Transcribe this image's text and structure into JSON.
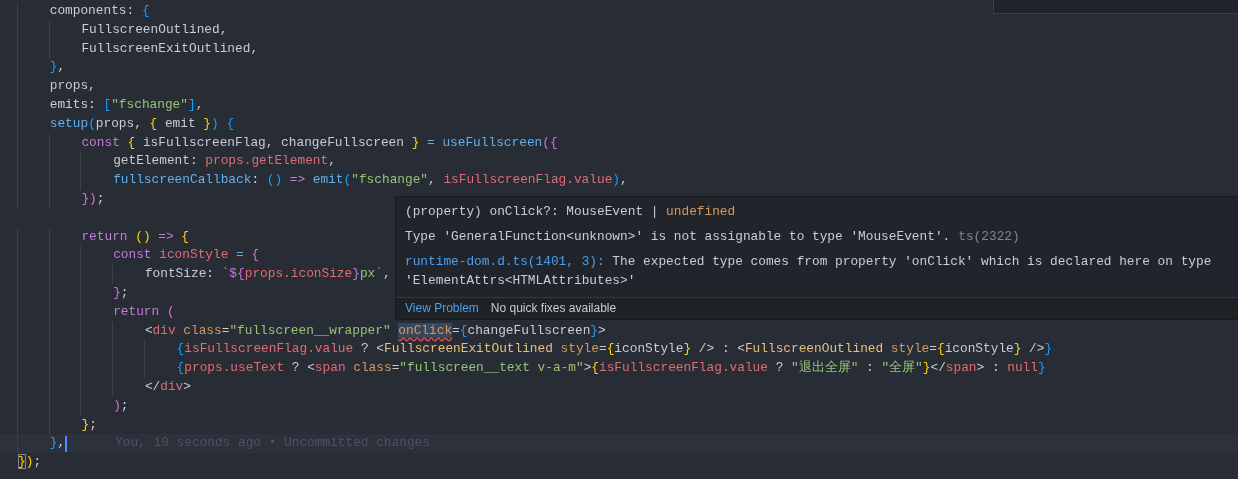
{
  "editor": {
    "lines": [
      {
        "kind": "code",
        "current": false,
        "tokens": [
          {
            "text": "    components: ",
            "kind": "plain"
          },
          {
            "text": "{",
            "kind": "bracket3"
          }
        ]
      },
      {
        "kind": "code",
        "current": false,
        "tokens": [
          {
            "text": "        FullscreenOutlined,",
            "kind": "plain"
          }
        ]
      },
      {
        "kind": "code",
        "current": false,
        "tokens": [
          {
            "text": "        FullscreenExitOutlined,",
            "kind": "plain"
          }
        ]
      },
      {
        "kind": "code",
        "current": false,
        "tokens": [
          {
            "text": "    }",
            "kind": "bracket3"
          },
          {
            "text": ",",
            "kind": "plain"
          }
        ]
      },
      {
        "kind": "code",
        "current": false,
        "tokens": [
          {
            "text": "    props,",
            "kind": "plain"
          }
        ]
      },
      {
        "kind": "code",
        "current": false,
        "tokens": [
          {
            "text": "    emits: ",
            "kind": "plain"
          },
          {
            "text": "[",
            "kind": "bracket3"
          },
          {
            "text": "\"fschange\"",
            "kind": "string"
          },
          {
            "text": "]",
            "kind": "bracket3"
          },
          {
            "text": ",",
            "kind": "plain"
          }
        ]
      },
      {
        "kind": "code",
        "current": false,
        "tokens": [
          {
            "text": "    setup",
            "kind": "function"
          },
          {
            "text": "(",
            "kind": "bracket3"
          },
          {
            "text": "props, ",
            "kind": "plain"
          },
          {
            "text": "{",
            "kind": "bracket1"
          },
          {
            "text": " emit ",
            "kind": "plain"
          },
          {
            "text": "}",
            "kind": "bracket1"
          },
          {
            "text": ") ",
            "kind": "bracket3"
          },
          {
            "text": "{",
            "kind": "bracket3"
          }
        ]
      },
      {
        "kind": "code",
        "current": false,
        "tokens": [
          {
            "text": "        const ",
            "kind": "keyword"
          },
          {
            "text": "{",
            "kind": "bracket1"
          },
          {
            "text": " isFullscreenFlag, changeFullscreen ",
            "kind": "plain"
          },
          {
            "text": "}",
            "kind": "bracket1"
          },
          {
            "text": " = ",
            "kind": "operator"
          },
          {
            "text": "useFullscreen",
            "kind": "function"
          },
          {
            "text": "({",
            "kind": "bracket2"
          }
        ]
      },
      {
        "kind": "code",
        "current": false,
        "tokens": [
          {
            "text": "            getElement: ",
            "kind": "plain"
          },
          {
            "text": "props.getElement",
            "kind": "variable"
          },
          {
            "text": ",",
            "kind": "plain"
          }
        ]
      },
      {
        "kind": "code",
        "current": false,
        "tokens": [
          {
            "text": "            fullscreenCallback",
            "kind": "function"
          },
          {
            "text": ": ",
            "kind": "plain"
          },
          {
            "text": "()",
            "kind": "bracket3"
          },
          {
            "text": " => ",
            "kind": "keyword"
          },
          {
            "text": "emit",
            "kind": "function"
          },
          {
            "text": "(",
            "kind": "bracket3"
          },
          {
            "text": "\"fschange\"",
            "kind": "string"
          },
          {
            "text": ", ",
            "kind": "plain"
          },
          {
            "text": "isFullscreenFlag.value",
            "kind": "variable"
          },
          {
            "text": ")",
            "kind": "bracket3"
          },
          {
            "text": ",",
            "kind": "plain"
          }
        ]
      },
      {
        "kind": "code",
        "current": false,
        "tokens": [
          {
            "text": "        })",
            "kind": "bracket2"
          },
          {
            "text": ";",
            "kind": "plain"
          }
        ]
      },
      {
        "kind": "blank"
      },
      {
        "kind": "code",
        "current": false,
        "tokens": [
          {
            "text": "        return ",
            "kind": "keyword"
          },
          {
            "text": "()",
            "kind": "bracket1"
          },
          {
            "text": " => ",
            "kind": "keyword"
          },
          {
            "text": "{",
            "kind": "bracket1"
          }
        ]
      },
      {
        "kind": "code",
        "current": false,
        "tokens": [
          {
            "text": "            const ",
            "kind": "keyword"
          },
          {
            "text": "iconStyle",
            "kind": "variable"
          },
          {
            "text": " = ",
            "kind": "operator"
          },
          {
            "text": "{",
            "kind": "bracket2"
          }
        ]
      },
      {
        "kind": "code",
        "current": false,
        "tokens": [
          {
            "text": "                fontSize: ",
            "kind": "plain"
          },
          {
            "text": "`",
            "kind": "string"
          },
          {
            "text": "${",
            "kind": "keyword"
          },
          {
            "text": "props.iconSize",
            "kind": "variable"
          },
          {
            "text": "}",
            "kind": "keyword"
          },
          {
            "text": "px`",
            "kind": "string"
          },
          {
            "text": ",",
            "kind": "plain"
          }
        ]
      },
      {
        "kind": "code",
        "current": false,
        "tokens": [
          {
            "text": "            }",
            "kind": "bracket2"
          },
          {
            "text": ";",
            "kind": "plain"
          }
        ]
      },
      {
        "kind": "code",
        "current": false,
        "tokens": [
          {
            "text": "            return ",
            "kind": "keyword"
          },
          {
            "text": "(",
            "kind": "bracket2"
          }
        ]
      },
      {
        "kind": "code",
        "current": false,
        "tokens": [
          {
            "text": "                <",
            "kind": "plain"
          },
          {
            "text": "div",
            "kind": "variable"
          },
          {
            "text": " class",
            "kind": "attr"
          },
          {
            "text": "=",
            "kind": "plain"
          },
          {
            "text": "\"fullscreen__wrapper\" ",
            "kind": "string"
          },
          {
            "text": "onClick",
            "kind": "attr-error"
          },
          {
            "text": "=",
            "kind": "plain"
          },
          {
            "text": "{",
            "kind": "bracket3"
          },
          {
            "text": "changeFullscreen",
            "kind": "plain"
          },
          {
            "text": "}",
            "kind": "bracket3"
          },
          {
            "text": ">",
            "kind": "plain"
          }
        ]
      },
      {
        "kind": "code",
        "current": false,
        "tokens": [
          {
            "text": "                    {",
            "kind": "bracket3"
          },
          {
            "text": "isFullscreenFlag.value",
            "kind": "variable"
          },
          {
            "text": " ? <",
            "kind": "plain"
          },
          {
            "text": "FullscreenExitOutlined",
            "kind": "component"
          },
          {
            "text": " style",
            "kind": "attr"
          },
          {
            "text": "=",
            "kind": "plain"
          },
          {
            "text": "{",
            "kind": "bracket1"
          },
          {
            "text": "iconStyle",
            "kind": "plain"
          },
          {
            "text": "}",
            "kind": "bracket1"
          },
          {
            "text": " /> : <",
            "kind": "plain"
          },
          {
            "text": "FullscreenOutlined",
            "kind": "component"
          },
          {
            "text": " style",
            "kind": "attr"
          },
          {
            "text": "=",
            "kind": "plain"
          },
          {
            "text": "{",
            "kind": "bracket1"
          },
          {
            "text": "iconStyle",
            "kind": "plain"
          },
          {
            "text": "}",
            "kind": "bracket1"
          },
          {
            "text": " />",
            "kind": "plain"
          },
          {
            "text": "}",
            "kind": "bracket3"
          }
        ]
      },
      {
        "kind": "code",
        "current": false,
        "tokens": [
          {
            "text": "                    {",
            "kind": "bracket3"
          },
          {
            "text": "props.useText",
            "kind": "variable"
          },
          {
            "text": " ? <",
            "kind": "plain"
          },
          {
            "text": "span",
            "kind": "variable"
          },
          {
            "text": " class",
            "kind": "attr"
          },
          {
            "text": "=",
            "kind": "plain"
          },
          {
            "text": "\"fullscreen__text v-a-m\"",
            "kind": "string"
          },
          {
            "text": ">",
            "kind": "plain"
          },
          {
            "text": "{",
            "kind": "bracket1"
          },
          {
            "text": "isFullscreenFlag.value",
            "kind": "variable"
          },
          {
            "text": " ? ",
            "kind": "plain"
          },
          {
            "text": "\"退出全屏\"",
            "kind": "string"
          },
          {
            "text": " : ",
            "kind": "plain"
          },
          {
            "text": "\"全屏\"",
            "kind": "string"
          },
          {
            "text": "}",
            "kind": "bracket1"
          },
          {
            "text": "</",
            "kind": "plain"
          },
          {
            "text": "span",
            "kind": "variable"
          },
          {
            "text": "> : ",
            "kind": "plain"
          },
          {
            "text": "null",
            "kind": "variable"
          },
          {
            "text": "}",
            "kind": "bracket3"
          }
        ]
      },
      {
        "kind": "code",
        "current": false,
        "tokens": [
          {
            "text": "                </",
            "kind": "plain"
          },
          {
            "text": "div",
            "kind": "variable"
          },
          {
            "text": ">",
            "kind": "plain"
          }
        ]
      },
      {
        "kind": "code",
        "current": false,
        "tokens": [
          {
            "text": "            )",
            "kind": "bracket2"
          },
          {
            "text": ";",
            "kind": "plain"
          }
        ]
      },
      {
        "kind": "code",
        "current": false,
        "tokens": [
          {
            "text": "        }",
            "kind": "bracket1"
          },
          {
            "text": ";",
            "kind": "plain"
          }
        ]
      },
      {
        "kind": "code",
        "current": true,
        "blame": "You, 19 seconds ago • Uncommitted changes",
        "tokens": [
          {
            "text": "    }",
            "kind": "bracket3"
          },
          {
            "text": ",",
            "kind": "plain"
          }
        ]
      },
      {
        "kind": "code",
        "current": false,
        "tokens": [
          {
            "text": "}",
            "kind": "bracket-match"
          },
          {
            "text": ")",
            "kind": "bracket1"
          },
          {
            "text": ";",
            "kind": "plain"
          }
        ]
      }
    ]
  },
  "hover": {
    "signature": [
      {
        "text": "(property) onClick?: MouseEvent | ",
        "kind": "plain"
      },
      {
        "text": "undefined",
        "kind": "type-keyword"
      }
    ],
    "message": "Type 'GeneralFunction<unknown>' is not assignable to type 'MouseEvent'.",
    "code": "ts(2322)",
    "related_link": "runtime-dom.d.ts(1401, 3):",
    "related_text": " The expected type comes from property 'onClick' which is declared here on type 'ElementAttrs<HTMLAttributes>'",
    "actions": [
      {
        "label": "View Problem",
        "kind": "link"
      },
      {
        "label": "No quick fixes available",
        "kind": "note"
      }
    ]
  }
}
